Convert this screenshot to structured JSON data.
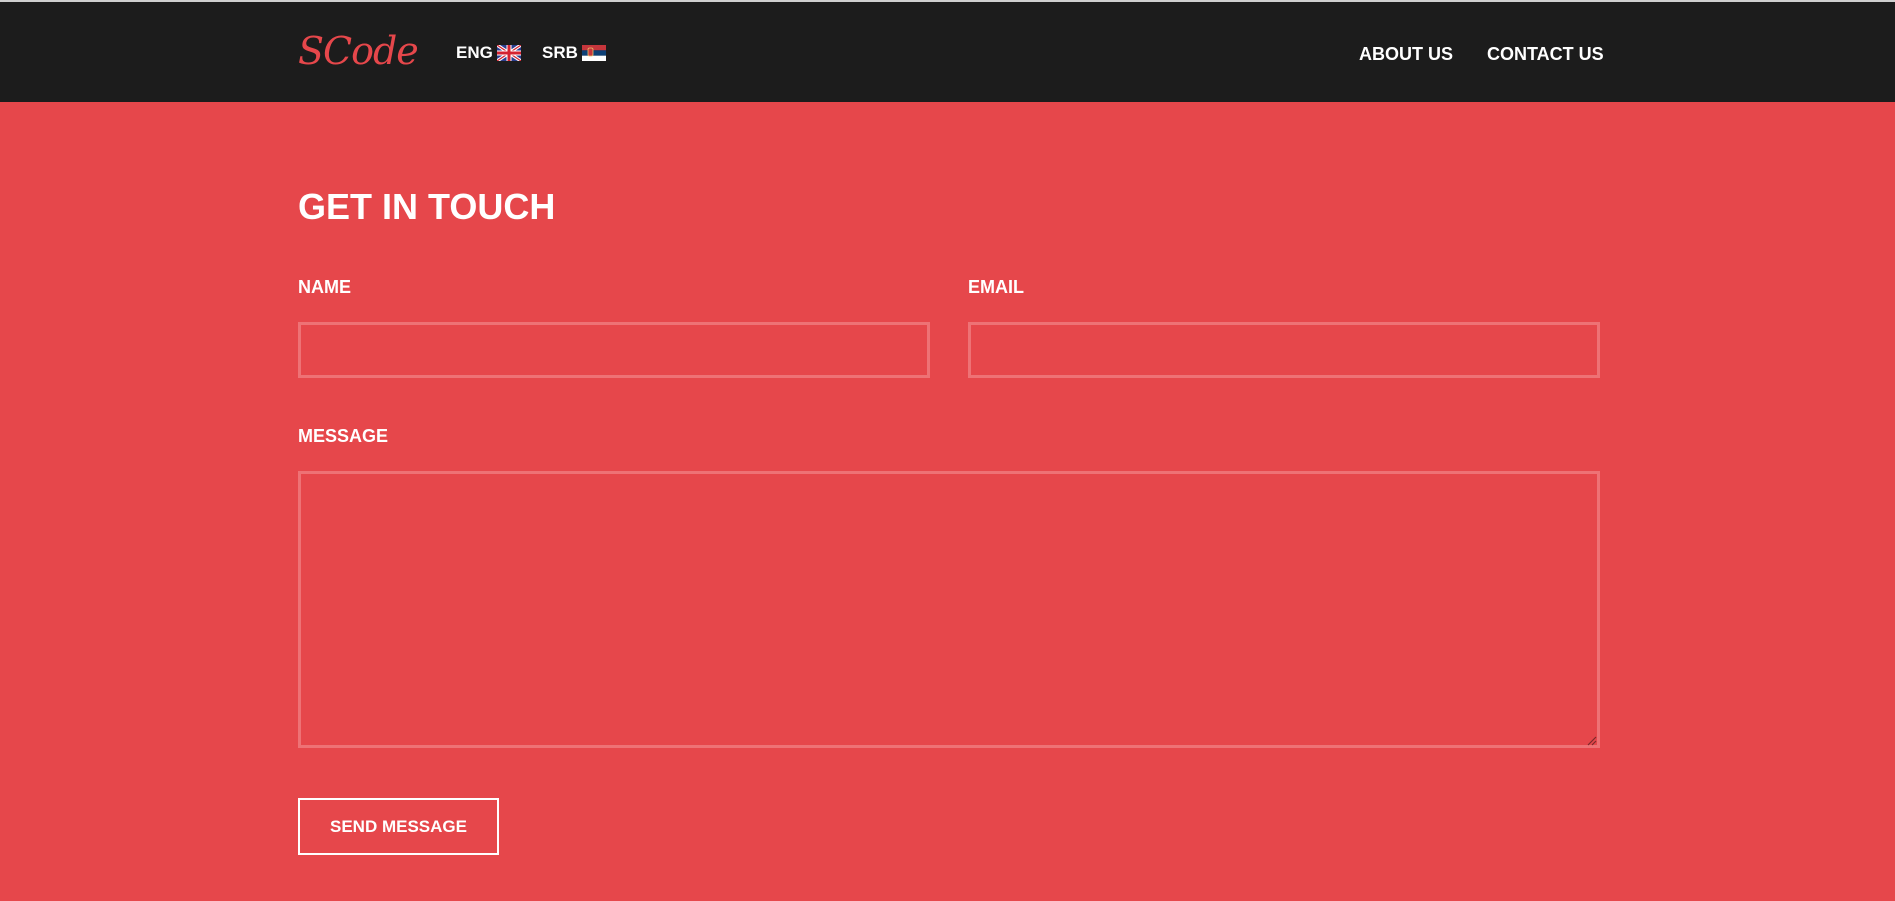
{
  "brand": {
    "logo": "SCode",
    "color": "#e6474b"
  },
  "nav": {
    "languages": [
      {
        "label": "ENG",
        "flag": "uk-flag-icon"
      },
      {
        "label": "SRB",
        "flag": "serbia-flag-icon"
      }
    ],
    "links": [
      {
        "label": "ABOUT US"
      },
      {
        "label": "CONTACT US"
      }
    ]
  },
  "form": {
    "title": "GET IN TOUCH",
    "name_label": "NAME",
    "email_label": "EMAIL",
    "message_label": "MESSAGE",
    "name_value": "",
    "email_value": "",
    "message_value": "",
    "submit_label": "SEND MESSAGE"
  },
  "colors": {
    "background": "#e6474b",
    "navbar": "#1c1c1c",
    "field_border": "#ee7275",
    "text": "#ffffff"
  }
}
